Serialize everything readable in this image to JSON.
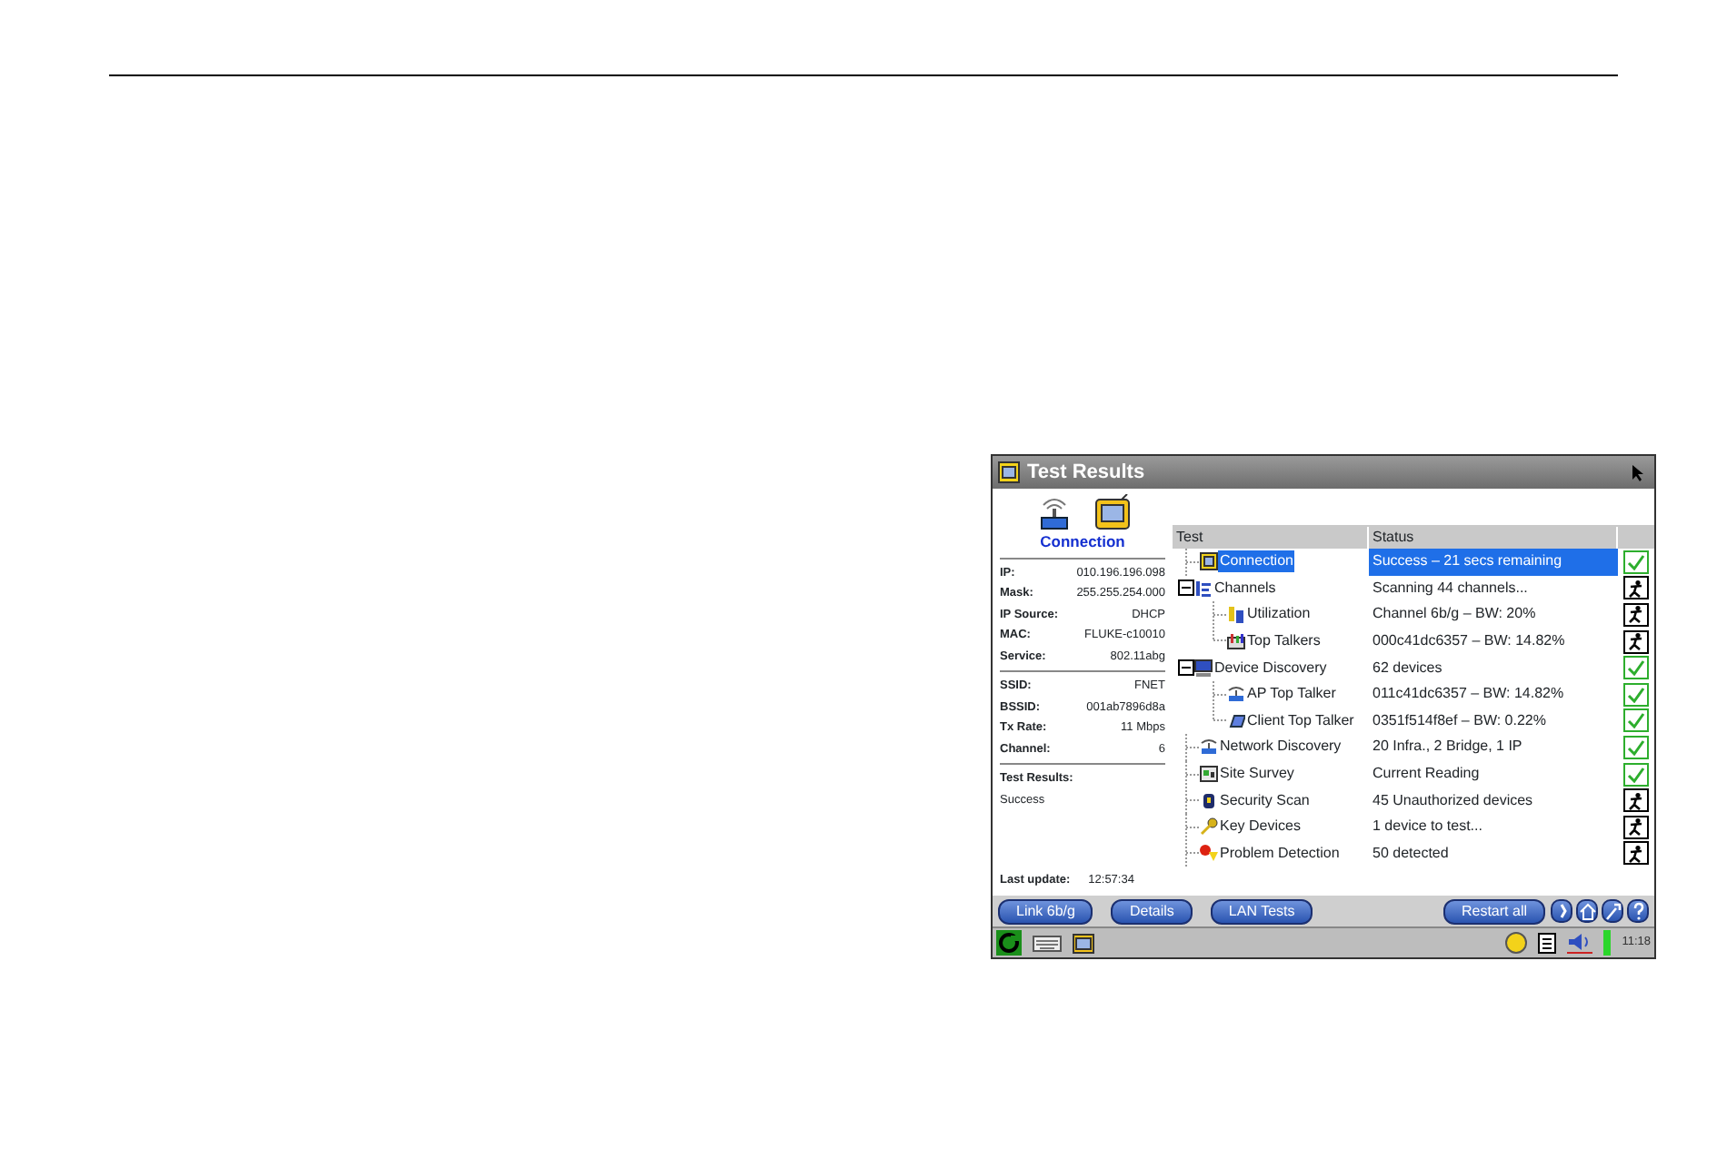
{
  "window": {
    "title": "Test Results"
  },
  "summary": {
    "label": "Connection",
    "groups": [
      [
        {
          "label": "IP:",
          "value": "010.196.196.098"
        },
        {
          "label": "Mask:",
          "value": "255.255.254.000"
        },
        {
          "label": "IP Source:",
          "value": "DHCP"
        },
        {
          "label": "MAC:",
          "value": "FLUKE-c10010"
        },
        {
          "label": "Service:",
          "value": "802.11abg"
        }
      ],
      [
        {
          "label": "SSID:",
          "value": "FNET"
        },
        {
          "label": "BSSID:",
          "value": "001ab7896d8a"
        },
        {
          "label": "Tx Rate:",
          "value": "11 Mbps"
        },
        {
          "label": "Channel:",
          "value": "6"
        }
      ]
    ],
    "result_label": "Test Results:",
    "result_value": "Success",
    "update_label": "Last update:",
    "update_value": "12:57:34"
  },
  "table": {
    "columns": [
      "Test",
      "Status"
    ],
    "rows": [
      {
        "test": "Connection",
        "status": "Success – 21 secs remaining",
        "passed": true,
        "selected": true,
        "kind": "monitor"
      },
      {
        "test": "Channels",
        "status": "Scanning 44 channels...",
        "passed": false,
        "selected": false,
        "kind": "bars",
        "expanded": true,
        "children": [
          {
            "test": "Utilization",
            "status": "Channel 6b/g – BW: 20%",
            "passed": false,
            "selected": false,
            "kind": "cylinders"
          },
          {
            "test": "Top Talkers",
            "status": "000c41dc6357 – BW: 14.82%",
            "passed": false,
            "selected": false,
            "kind": "chart"
          }
        ]
      },
      {
        "test": "Device Discovery",
        "status": "62 devices",
        "passed": true,
        "selected": false,
        "kind": "computer",
        "expanded": true,
        "children": [
          {
            "test": "AP Top Talker",
            "status": "011c41dc6357 – BW: 14.82%",
            "passed": true,
            "selected": false,
            "kind": "ap"
          },
          {
            "test": "Client Top Talker",
            "status": "0351f514f8ef – BW: 0.22%",
            "passed": true,
            "selected": false,
            "kind": "card"
          }
        ]
      },
      {
        "test": "Network Discovery",
        "status": "20 Infra., 2 Bridge, 1 IP",
        "passed": true,
        "selected": false,
        "kind": "ap"
      },
      {
        "test": "Site Survey",
        "status": "Current Reading",
        "passed": true,
        "selected": false,
        "kind": "survey"
      },
      {
        "test": "Security Scan",
        "status": "45 Unauthorized devices",
        "passed": false,
        "selected": false,
        "kind": "lock"
      },
      {
        "test": "Key Devices",
        "status": "1 device to test...",
        "passed": false,
        "selected": false,
        "kind": "key"
      },
      {
        "test": "Problem Detection",
        "status": "50 detected",
        "passed": false,
        "selected": false,
        "kind": "alert"
      }
    ]
  },
  "buttons": [
    "Link 6b/g",
    "Details",
    "LAN Tests",
    "Restart all"
  ],
  "taskbar": {
    "time": "11:18"
  }
}
